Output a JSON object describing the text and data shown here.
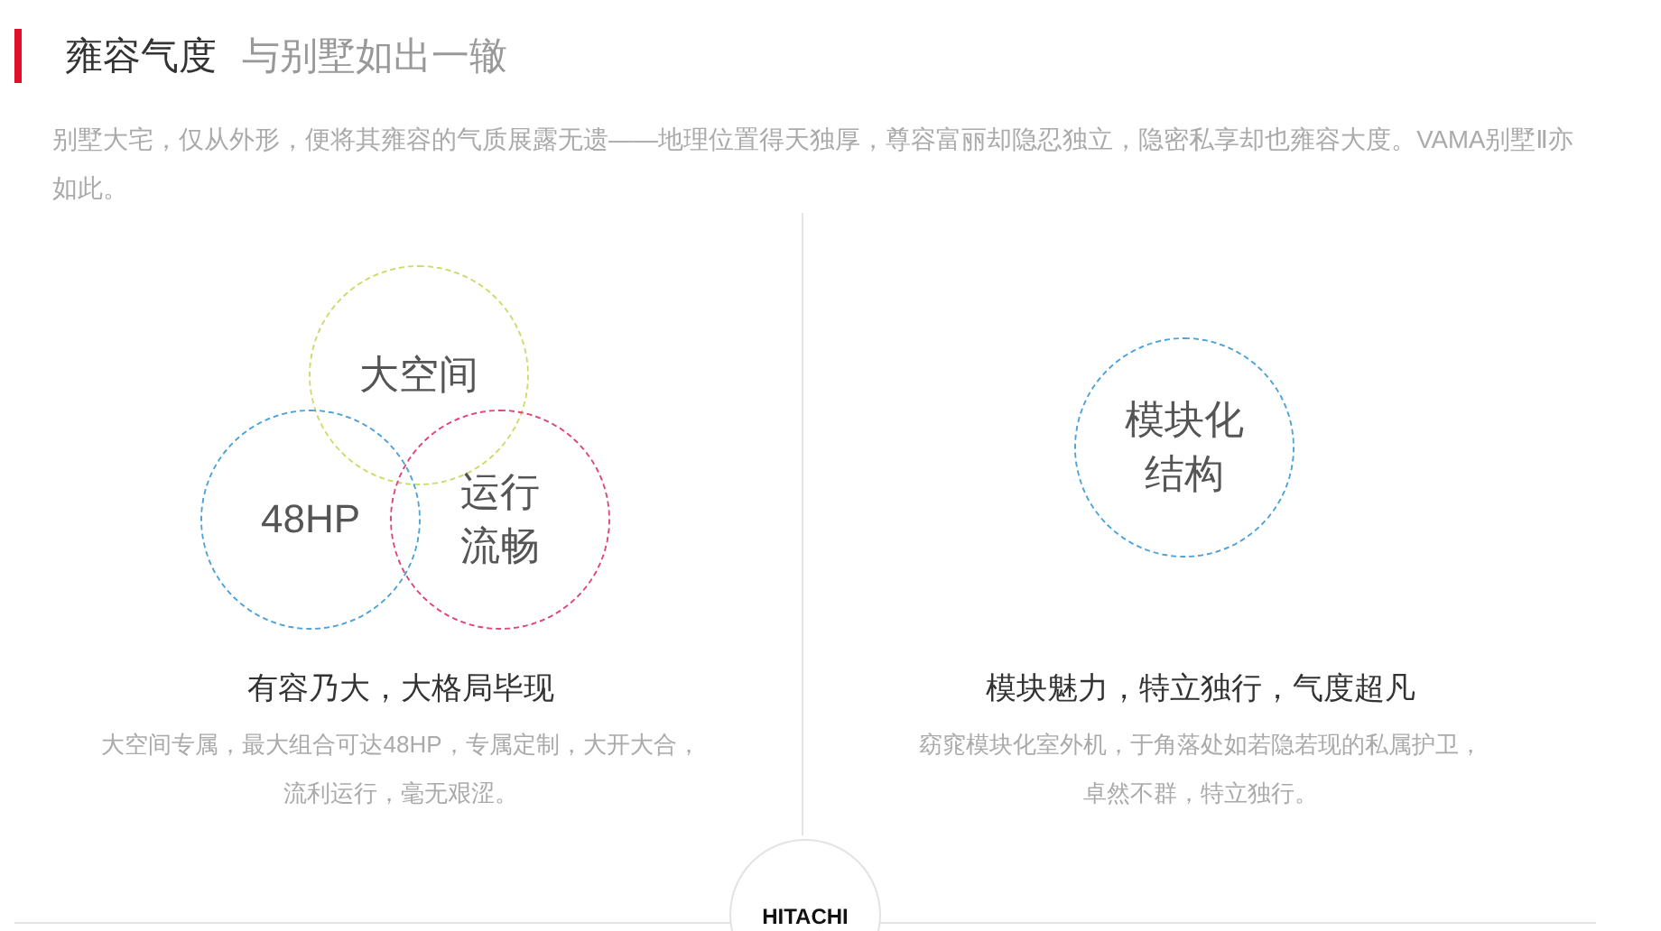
{
  "header": {
    "title": "雍容气度",
    "subtitle": "与别墅如出一辙"
  },
  "intro": "别墅大宅，仅从外形，便将其雍容的气质展露无遗——地理位置得天独厚，尊容富丽却隐忍独立，隐密私享却也雍容大度。VAMA别墅Ⅱ亦如此。",
  "features": [
    {
      "kind": "trio",
      "bubbles": [
        {
          "lines": [
            "大空间"
          ],
          "color": "#cbdc6e"
        },
        {
          "lines": [
            "48HP"
          ],
          "color": "#4fa3d8"
        },
        {
          "lines": [
            "运行",
            "流畅"
          ],
          "color": "#e0457b"
        }
      ],
      "title": "有容乃大，大格局毕现",
      "description_lines": [
        "大空间专属，最大组合可达48HP，专属定制，大开大合，",
        "流利运行，毫无艰涩。"
      ]
    },
    {
      "kind": "single",
      "bubbles": [
        {
          "lines": [
            "模块化",
            "结构"
          ],
          "color": "#4fa3d8"
        }
      ],
      "title": "模块魅力，特立独行，气度超凡",
      "description_lines": [
        "窈窕模块化室外机，于角落处如若隐若现的私属护卫，",
        "卓然不群，特立独行。"
      ]
    }
  ],
  "logo": "HITACHI"
}
